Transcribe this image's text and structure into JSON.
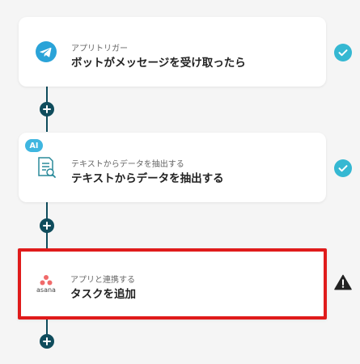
{
  "flow": {
    "steps": [
      {
        "sub": "アプリトリガー",
        "main": "ボットがメッセージを受け取ったら",
        "icon": "telegram-icon",
        "status": "completed-check-icon"
      },
      {
        "sub": "テキストからデータを抽出する",
        "main": "テキストからデータを抽出する",
        "icon": "ocr-document-icon",
        "badge": "AI",
        "status": "completed-check-icon"
      },
      {
        "sub": "アプリと連携する",
        "main": "タスクを追加",
        "icon": "asana-icon",
        "icon_text": "asana",
        "status": "warning-icon"
      }
    ]
  },
  "colors": {
    "connector": "#0f4c5c",
    "check": "#35b8d2",
    "highlight": "#e01b1b",
    "asana": "#f06a6a",
    "ai_badge": "#3fb6e0"
  }
}
